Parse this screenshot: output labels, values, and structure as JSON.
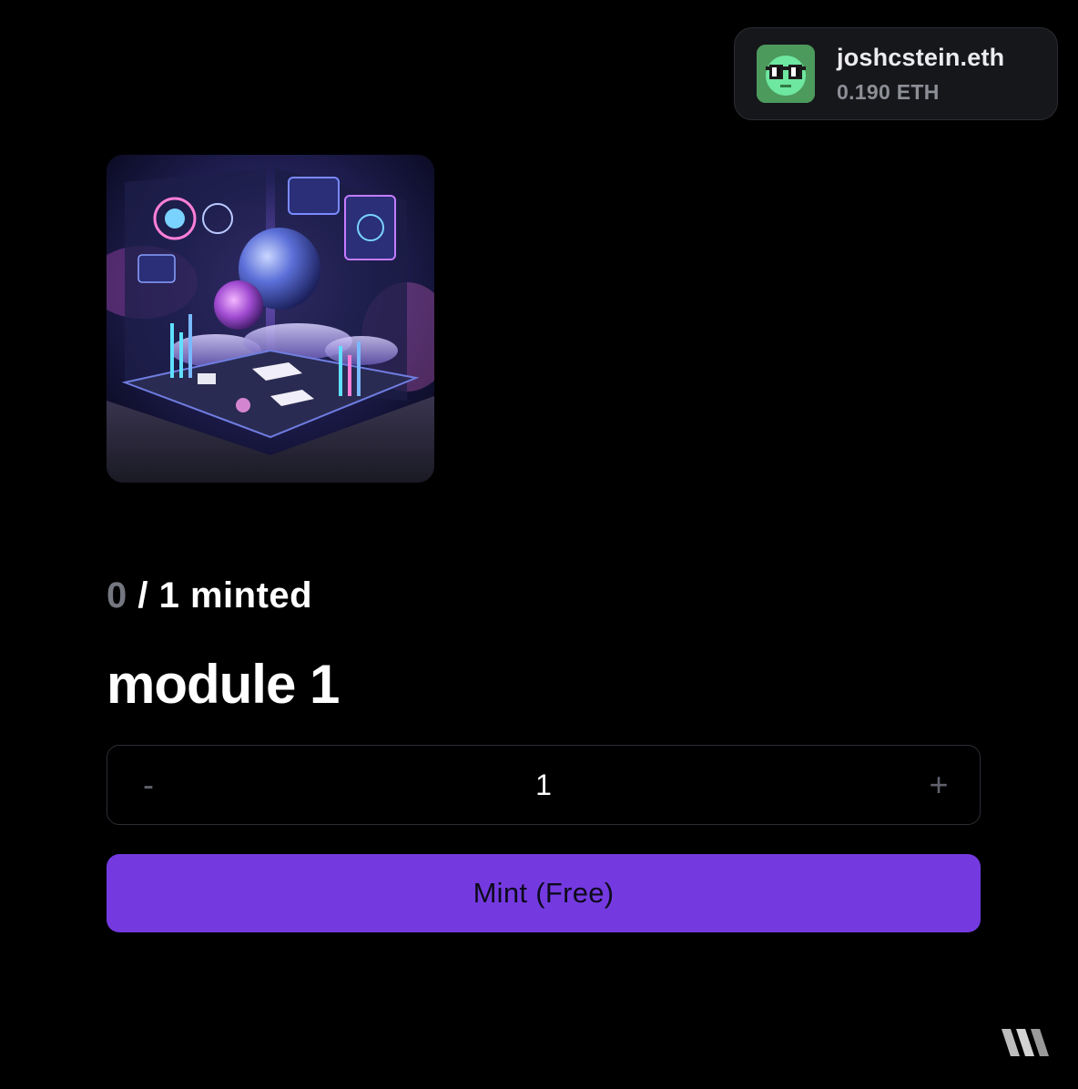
{
  "wallet": {
    "ens_name": "joshcstein.eth",
    "balance": "0.190 ETH",
    "avatar_icon": "pixel-glasses-avatar-icon",
    "avatar_color": "#4c9a5c"
  },
  "nft": {
    "image_description_icon": "artwork-image",
    "minted_count": "0",
    "minted_total": " / 1 minted",
    "title": "module 1"
  },
  "quantity": {
    "decrement_label": "-",
    "value": "1",
    "increment_label": "+"
  },
  "mint_button": {
    "label": "Mint (Free)",
    "color": "#743ae0"
  },
  "brand": {
    "icon": "brand-logo-icon"
  }
}
